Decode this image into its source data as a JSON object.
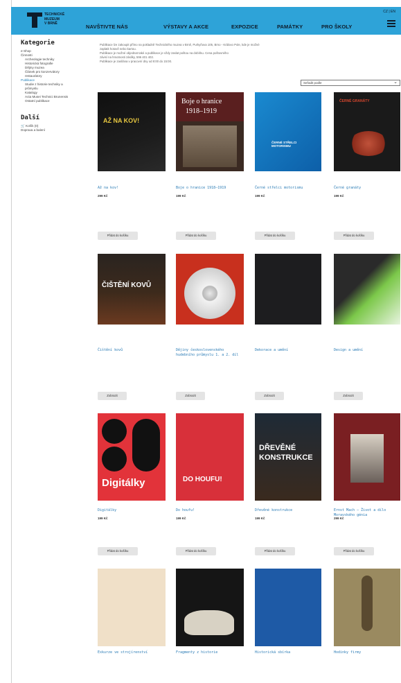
{
  "header": {
    "logo_lines": [
      "TECHNICKÉ",
      "MUZEUM",
      "V BRNĚ"
    ],
    "lang": "CZ | EN",
    "nav": [
      "NAVŠTIVTE NÁS",
      "VÝSTAVY A AKCE",
      "EXPOZICE",
      "PAMÁTKY",
      "PRO ŠKOLY"
    ]
  },
  "sidebar": {
    "heading": "Kategorie",
    "items": [
      {
        "label": "e-Shop",
        "level": 0,
        "highlight": false
      },
      {
        "label": "Činnosti",
        "level": 0,
        "highlight": false
      },
      {
        "label": "Archeologie techniky",
        "level": 1,
        "highlight": false
      },
      {
        "label": "Historická fotografie",
        "level": 1,
        "highlight": false
      },
      {
        "label": "Dějiny muzea",
        "level": 1,
        "highlight": false
      },
      {
        "label": "Článek pro konzervátory",
        "level": 1,
        "highlight": false
      },
      {
        "label": "restaurátory",
        "level": 1,
        "highlight": false
      },
      {
        "label": "Publikace",
        "level": 0,
        "highlight": true
      },
      {
        "label": "Studie z historie techniky a",
        "level": 1,
        "highlight": false
      },
      {
        "label": "průmyslu",
        "level": 1,
        "highlight": false
      },
      {
        "label": "Katalogy",
        "level": 1,
        "highlight": false
      },
      {
        "label": "Acta Musei Technici Brunensis",
        "level": 1,
        "highlight": false
      },
      {
        "label": "Ostatní publikace",
        "level": 1,
        "highlight": false
      }
    ],
    "heading2": "Další",
    "items2": [
      "Košík (0)",
      "Doprava a balení"
    ]
  },
  "intro": {
    "lines": [
      "Publikace lze zakoupit přímo na pokladně Technického muzea v Brně, Purkyňova 105, Brno - Královo Pole, kde je možné",
      "zaplatit hotově nebo kartou.",
      "Publikace je možné objednat také a publikace je vždy zaslat poštou na dobírku. Cena poštovného",
      "závisí na hmotnosti zásilky, 596 401 402.",
      "Publikace je zasílána v pracovní dny od 8:00 do 15:00."
    ]
  },
  "sort": {
    "label": "Seřadit podle"
  },
  "products": [
    {
      "title": "Až na kov!",
      "price": "299 Kč",
      "button": "Přidat do košíku",
      "cover": "az-na-kov"
    },
    {
      "title": "Boje o hranice 1918–1919",
      "price": "199 Kč",
      "button": "Přidat do košíku",
      "cover": "boje"
    },
    {
      "title": "Černé střelci motorismu",
      "price": "199 Kč",
      "button": "Přidat do košíku",
      "cover": "motorismu"
    },
    {
      "title": "Černé granáty",
      "price": "199 Kč",
      "button": "Přidat do košíku",
      "cover": "granaty"
    },
    {
      "title": "Čištění kovů",
      "price": "",
      "button": "Zobrazit",
      "cover": "cisteni"
    },
    {
      "title": "Dějiny československého hudebního průmyslu 1. a 2. díl",
      "price": "",
      "button": "Zobrazit",
      "cover": "dejiny"
    },
    {
      "title": "Dekorace a umění",
      "price": "",
      "button": "Zobrazit",
      "cover": "dark"
    },
    {
      "title": "Design a umění",
      "price": "",
      "button": "Zobrazit",
      "cover": "green"
    },
    {
      "title": "Digitálky",
      "price": "199 Kč",
      "button": "Přidat do košíku",
      "cover": "digitalky"
    },
    {
      "title": "Do houfu!",
      "price": "199 Kč",
      "button": "Přidat do košíku",
      "cover": "houfu"
    },
    {
      "title": "Dřevěné konstrukce",
      "price": "199 Kč",
      "button": "Přidat do košíku",
      "cover": "drevene"
    },
    {
      "title": "Ernst Mach – Život a dílo Moravského génia",
      "price": "299 Kč",
      "button": "Přidat do košíku",
      "cover": "mach"
    },
    {
      "title": "Exkurze ve strojírenství",
      "price": "",
      "button": "",
      "cover": "exkurze"
    },
    {
      "title": "Fragmenty z historie",
      "price": "",
      "button": "",
      "cover": "fragmenty"
    },
    {
      "title": "Historická sbírka",
      "price": "",
      "button": "",
      "cover": "sbirka"
    },
    {
      "title": "Hodinky firmy",
      "price": "",
      "button": "",
      "cover": "hodinky"
    }
  ],
  "cover_text": {
    "az_na_kov": "AŽ NA KOV!",
    "boje_l1": "Boje o hranice",
    "boje_l2": "1918–1919",
    "motorismu": "ČERNÉ STŘELCI MOTORISMU",
    "granaty": "ČERNÉ GRANÁTY",
    "cisteni": "ČIŠTĚNÍ KOVŮ",
    "digitalky": "Digitálky",
    "houfu": "DO HOUFU!",
    "drevene_l1": "DŘEVĚNÉ",
    "drevene_l2": "KONSTRUKCE"
  }
}
